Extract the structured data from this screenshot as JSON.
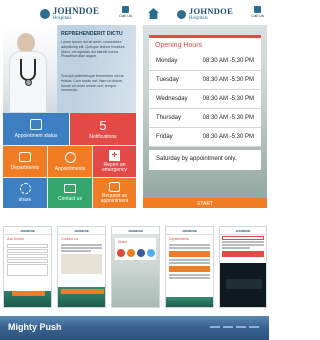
{
  "app": {
    "brand": "JOHNDOE",
    "subbrand": "Hospitals",
    "call_label": "Call Us"
  },
  "intro": {
    "heading": "REPREHENDERIT DICTU",
    "para1": "Lorem ipsum dol sit amet, consectetur adipisicing elit. Quisque finibus tincidunt libero, vel egestas dui blandit nonus. Phasellus vitae augue.",
    "para2": "Suscipit pellentesque fermentum nisi at finibus. Cum sociis nat. Nam ut dictum, dolore sit amet ornare sed, tempor commodo."
  },
  "tiles": {
    "appointment": "Appointment status",
    "notifications_count": "5",
    "notifications": "Notifications",
    "departments": "Departments",
    "appointments": "Appointments",
    "emergency": "Report an emergency",
    "share": "share",
    "contact": "Contact us",
    "request": "Request an appointment"
  },
  "hours": {
    "title": "Opening Hours",
    "days": [
      {
        "day": "Monday",
        "time": "08:30 AM -5:30 PM"
      },
      {
        "day": "Tuesday",
        "time": "08:30 AM -5:30 PM"
      },
      {
        "day": "Wednesday",
        "time": "08:30 AM -5:30 PM"
      },
      {
        "day": "Thursday",
        "time": "08:30 AM -5:30 PM"
      },
      {
        "day": "Friday",
        "time": "08:30 AM -5:30 PM"
      }
    ],
    "saturday": "Saturday by appointment only.",
    "start": "START"
  },
  "thumbs": {
    "t1_title": "Ask Doctor",
    "t2_title": "Contact Us",
    "t3_title": "Share",
    "t4_title": "Departments"
  },
  "footer": {
    "title": "Mighty Push"
  },
  "colors": {
    "blue": "#3e7fc1",
    "orange": "#f07c24",
    "red": "#e34a45",
    "green": "#33a86a",
    "footer": "#3a6390"
  }
}
